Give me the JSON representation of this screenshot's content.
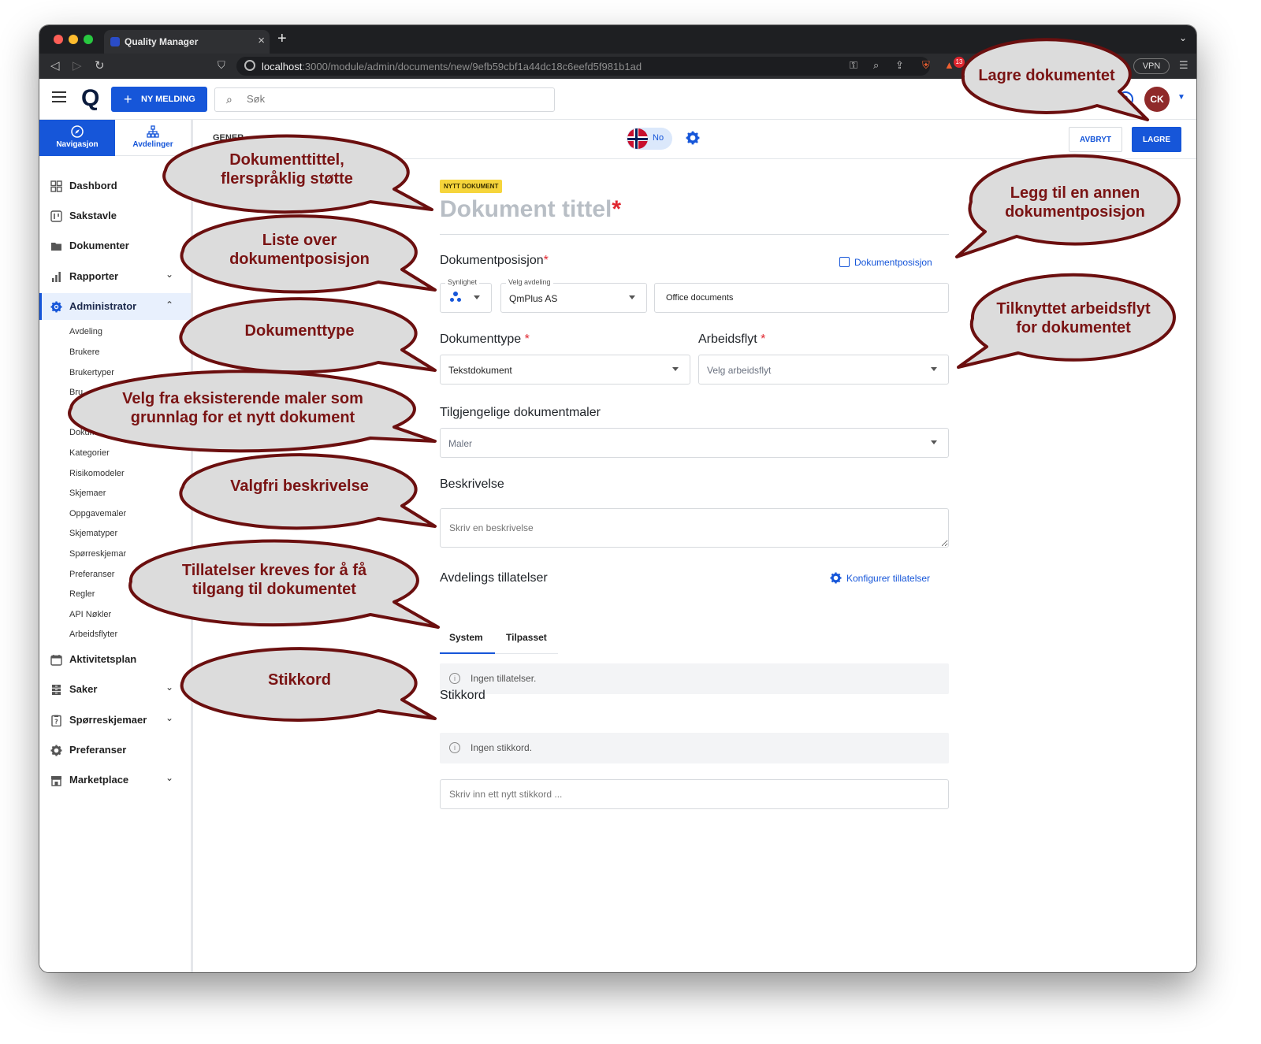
{
  "browser": {
    "tab_title": "Quality Manager",
    "url_host": "localhost",
    "url_rest": ":3000/module/admin/documents/new/9efb59cbf1a44dc18c6eefd5f981b1ad",
    "vpn_label": "VPN",
    "notification_count": "13"
  },
  "header": {
    "logo": "Q",
    "new_message_label": "NY MELDING",
    "search_placeholder": "Søk",
    "avatar_initials": "CK"
  },
  "sidebar": {
    "tabs": [
      {
        "label": "Navigasjon"
      },
      {
        "label": "Avdelinger"
      }
    ],
    "items": [
      {
        "label": "Dashbord"
      },
      {
        "label": "Sakstavle"
      },
      {
        "label": "Dokumenter"
      },
      {
        "label": "Rapporter"
      },
      {
        "label": "Administrator"
      },
      {
        "label": "Aktivitetsplan"
      },
      {
        "label": "Saker"
      },
      {
        "label": "Spørreskjemaer"
      },
      {
        "label": "Preferanser"
      },
      {
        "label": "Marketplace"
      }
    ],
    "admin_subitems": [
      "Avdeling",
      "Brukere",
      "Brukertyper",
      "Bru",
      "",
      "Dokume",
      "Kategorier",
      "Risikomodeler",
      "Skjemaer",
      "Oppgavemaler",
      "Skjematyper",
      "Spørreskjemar",
      "Preferanser",
      "Regler",
      "API Nøkler",
      "Arbeidsflyter"
    ]
  },
  "toolbar": {
    "section_label": "GENER",
    "language": "No",
    "cancel_label": "AVBRYT",
    "save_label": "LAGRE"
  },
  "form": {
    "badge": "NYTT DOKUMENT",
    "title_placeholder": "Dokument tittel",
    "required_mark": "*",
    "position_label": "Dokumentposisjon",
    "add_position_link": "Dokumentposisjon",
    "visibility_label": "Synlighet",
    "department_label": "Velg avdeling",
    "department_value": "QmPlus AS",
    "folder_value": "Office documents",
    "doctype_label": "Dokumenttype",
    "doctype_value": "Tekstdokument",
    "workflow_label": "Arbeidsflyt",
    "workflow_placeholder": "Velg arbeidsflyt",
    "templates_label": "Tilgjengelige dokumentmaler",
    "templates_placeholder": "Maler",
    "description_label": "Beskrivelse",
    "description_placeholder": "Skriv en beskrivelse",
    "permissions_label": "Avdelings tillatelser",
    "configure_link": "Konfigurer tillatelser",
    "permission_tabs": [
      "System",
      "Tilpasset"
    ],
    "no_permissions": "Ingen tillatelser.",
    "keywords_label": "Stikkord",
    "no_keywords": "Ingen stikkord.",
    "keyword_placeholder": "Skriv inn ett nytt stikkord ..."
  },
  "callouts": {
    "save": "Lagre dokumentet",
    "title": [
      "Dokumenttittel,",
      "flerspråklig støtte"
    ],
    "position_list": [
      "Liste over",
      "dokumentposisjon"
    ],
    "add_position": [
      "Legg til en annen",
      "dokumentposisjon"
    ],
    "doctype": "Dokumenttype",
    "workflow": [
      "Tilknyttet arbeidsflyt",
      "for dokumentet"
    ],
    "templates": [
      "Velg fra eksisterende maler som",
      "grunnlag for et nytt dokument"
    ],
    "description": "Valgfri beskrivelse",
    "permissions": [
      "Tillatelser kreves for å få",
      "tilgang til dokumentet"
    ],
    "keywords": "Stikkord"
  },
  "colors": {
    "accent": "#1656d9",
    "callout_fill": "#dcdcdc",
    "callout_border": "#6b0f0f",
    "callout_text": "#7a1414",
    "badge": "#f6d53b",
    "avatar": "#8f2a2a"
  }
}
